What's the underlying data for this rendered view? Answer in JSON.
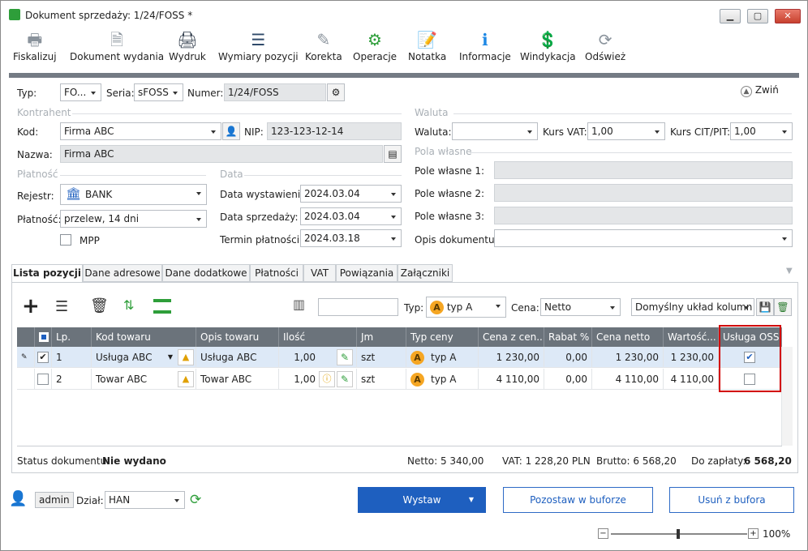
{
  "window": {
    "title": "Dokument sprzedaży: 1/24/FOSS *"
  },
  "toolbar": {
    "items": [
      {
        "label": "Fiskalizuj",
        "icon": "printer-fiscal-icon"
      },
      {
        "label": "Dokument wydania",
        "icon": "document-out-icon"
      },
      {
        "label": "Wydruk",
        "icon": "print-icon"
      },
      {
        "label": "Wymiary pozycji",
        "icon": "list-icon"
      },
      {
        "label": "Korekta",
        "icon": "pencil-icon"
      },
      {
        "label": "Operacje",
        "icon": "gears-icon"
      },
      {
        "label": "Notatka",
        "icon": "note-icon"
      },
      {
        "label": "Informacje",
        "icon": "info-icon"
      },
      {
        "label": "Windykacja",
        "icon": "collection-icon"
      },
      {
        "label": "Odśwież",
        "icon": "refresh-icon"
      }
    ]
  },
  "header": {
    "typ_label": "Typ:",
    "typ_value": "FO...",
    "seria_label": "Seria:",
    "seria_value": "sFOSS",
    "numer_label": "Numer:",
    "numer_value": "1/24/FOSS",
    "collapse_label": "Zwiń"
  },
  "kontrahent": {
    "section": "Kontrahent",
    "kod_label": "Kod:",
    "kod_value": "Firma ABC",
    "nip_label": "NIP:",
    "nip_value": "123-123-12-14",
    "nazwa_label": "Nazwa:",
    "nazwa_value": "Firma ABC"
  },
  "waluta": {
    "section": "Waluta",
    "waluta_label": "Waluta:",
    "waluta_value": "",
    "kurs_vat_label": "Kurs VAT:",
    "kurs_vat_value": "1,00",
    "kurs_cit_label": "Kurs CIT/PIT:",
    "kurs_cit_value": "1,00"
  },
  "pola": {
    "section": "Pola własne",
    "p1": "Pole własne 1:",
    "p2": "Pole własne 2:",
    "p3": "Pole własne 3:",
    "opis": "Opis dokumentu:"
  },
  "platnosc": {
    "section": "Płatność",
    "rejestr_label": "Rejestr:",
    "rejestr_value": "BANK",
    "platnosc_label": "Płatność:",
    "platnosc_value": "przelew, 14 dni",
    "mpp_label": "MPP"
  },
  "data": {
    "section": "Data",
    "wyst_label": "Data wystawienia:",
    "wyst_value": "2024.03.04",
    "sprz_label": "Data sprzedaży:",
    "sprz_value": "2024.03.04",
    "term_label": "Termin płatności:",
    "term_value": "2024.03.18"
  },
  "tabs": [
    "Lista pozycji",
    "Dane adresowe",
    "Dane dodatkowe",
    "Płatności",
    "VAT",
    "Powiązania",
    "Załączniki"
  ],
  "grid_toolbar": {
    "typ_label": "Typ:",
    "typ_value": "typ A",
    "cena_label": "Cena:",
    "cena_value": "Netto",
    "layout_value": "Domyślny układ kolumn"
  },
  "grid": {
    "headers": [
      "Lp.",
      "Kod towaru",
      "Opis towaru",
      "Ilość",
      "Jm",
      "Typ ceny",
      "Cena z cen...",
      "Rabat %",
      "Cena netto",
      "Wartość...",
      "Usługa OSS"
    ],
    "rows": [
      {
        "lp": "1",
        "kod": "Usługa ABC",
        "opis": "Usługa ABC",
        "ilosc": "1,00",
        "jm": "szt",
        "typ": "typ A",
        "cena_z": "1 230,00",
        "rabat": "0,00",
        "netto": "1 230,00",
        "wartosc": "1 230,00",
        "oss": true,
        "selected": true
      },
      {
        "lp": "2",
        "kod": "Towar ABC",
        "opis": "Towar ABC",
        "ilosc": "1,00",
        "jm": "szt",
        "typ": "typ A",
        "cena_z": "4 110,00",
        "rabat": "0,00",
        "netto": "4 110,00",
        "wartosc": "4 110,00",
        "oss": false,
        "selected": false
      }
    ]
  },
  "summary": {
    "status_label": "Status dokumentu:",
    "status_value": "Nie wydano",
    "netto": "Netto:  5 340,00",
    "vat": "VAT:  1 228,20  PLN",
    "brutto": "Brutto:  6 568,20",
    "do_zaplaty_label": "Do zapłaty:",
    "do_zaplaty_value": "6 568,20"
  },
  "bottom": {
    "user": "admin",
    "dzial_label": "Dział:",
    "dzial_value": "HAN",
    "wystaw": "Wystaw",
    "pozostaw": "Pozostaw w buforze",
    "usun": "Usuń z bufora",
    "zoom": "100%"
  },
  "colors": {
    "accent": "#1e5fbf",
    "header_gray": "#6b737b",
    "highlight": "#d20000",
    "badge": "#f5a623"
  }
}
